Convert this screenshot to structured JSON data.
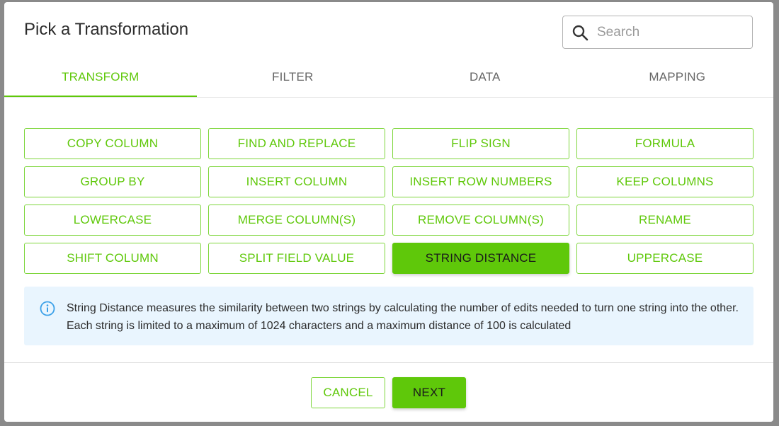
{
  "dialog": {
    "title": "Pick a Transformation",
    "search": {
      "placeholder": "Search",
      "value": "",
      "icon": "search-icon"
    }
  },
  "tabs": [
    {
      "label": "TRANSFORM",
      "active": true
    },
    {
      "label": "FILTER",
      "active": false
    },
    {
      "label": "DATA",
      "active": false
    },
    {
      "label": "MAPPING",
      "active": false
    }
  ],
  "transformations": [
    {
      "label": "COPY COLUMN",
      "selected": false
    },
    {
      "label": "FIND AND REPLACE",
      "selected": false
    },
    {
      "label": "FLIP SIGN",
      "selected": false
    },
    {
      "label": "FORMULA",
      "selected": false
    },
    {
      "label": "GROUP BY",
      "selected": false
    },
    {
      "label": "INSERT COLUMN",
      "selected": false
    },
    {
      "label": "INSERT ROW NUMBERS",
      "selected": false
    },
    {
      "label": "KEEP COLUMNS",
      "selected": false
    },
    {
      "label": "LOWERCASE",
      "selected": false
    },
    {
      "label": "MERGE COLUMN(S)",
      "selected": false
    },
    {
      "label": "REMOVE COLUMN(S)",
      "selected": false
    },
    {
      "label": "RENAME",
      "selected": false
    },
    {
      "label": "SHIFT COLUMN",
      "selected": false
    },
    {
      "label": "SPLIT FIELD VALUE",
      "selected": false
    },
    {
      "label": "STRING DISTANCE",
      "selected": true
    },
    {
      "label": "UPPERCASE",
      "selected": false
    }
  ],
  "info": {
    "icon": "info-icon",
    "text": "String Distance measures the similarity between two strings by calculating the number of edits needed to turn one string into the other. Each string is limited to a maximum of 1024 characters and a maximum distance of 100 is calculated"
  },
  "footer": {
    "cancel_label": "CANCEL",
    "next_label": "NEXT"
  },
  "colors": {
    "accent": "#5fc80a",
    "info_bg": "#e9f5fe",
    "info_icon": "#3aa0e8"
  }
}
